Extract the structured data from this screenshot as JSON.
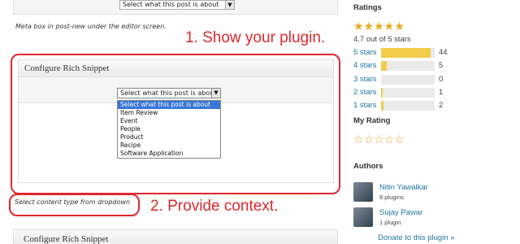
{
  "top_panel": {
    "select_text": "Select what this post is about",
    "caption": "Meta box in post-new under the editor screen."
  },
  "annotations": {
    "step1": "1. Show your plugin.",
    "step2": "2. Provide context."
  },
  "metabox": {
    "title": "Configure Rich Snippet",
    "dropdown_value": "Select what this post is about",
    "options": [
      "Select what this post is about",
      "Item Review",
      "Event",
      "People",
      "Product",
      "Recipe",
      "Software Application"
    ],
    "caption": "Select content type from dropdown"
  },
  "bottom_panel": {
    "title": "Configure Rich Snippet"
  },
  "sidebar": {
    "ratings_heading": "Ratings",
    "average_stars": "★★★★★",
    "average_text": "4.7 out of 5 stars",
    "rows": [
      {
        "label": "5 stars",
        "count": "44",
        "fraction": 0.92
      },
      {
        "label": "4 stars",
        "count": "5",
        "fraction": 0.1
      },
      {
        "label": "3 stars",
        "count": "0",
        "fraction": 0
      },
      {
        "label": "2 stars",
        "count": "1",
        "fraction": 0.025
      },
      {
        "label": "1 stars",
        "count": "2",
        "fraction": 0.045
      }
    ],
    "my_rating_heading": "My Rating",
    "my_rating_stars": "☆☆☆☆☆",
    "authors_heading": "Authors",
    "authors": [
      {
        "name": "Nitin Yawalkar",
        "plugins": "8 plugins"
      },
      {
        "name": "Sujay Pawar",
        "plugins": "1 plugin"
      }
    ],
    "donate": "Donate to this plugin »"
  },
  "colors": {
    "accent_red": "#e0282c",
    "link_blue": "#21759b",
    "star_gold": "#f0a81e",
    "bar_fill": "#f2cd48"
  }
}
